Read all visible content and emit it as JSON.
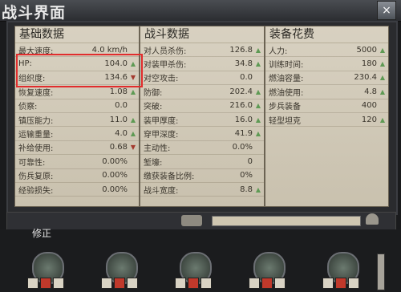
{
  "window": {
    "title": "战斗界面",
    "close_label": "×"
  },
  "panels": {
    "basic": {
      "title": "基础数据",
      "rows": [
        {
          "label": "最大速度:",
          "value": "4.0 km/h",
          "ind": ""
        },
        {
          "label": "HP:",
          "value": "104.0",
          "ind": "up"
        },
        {
          "label": "组织度:",
          "value": "134.6",
          "ind": "down"
        },
        {
          "label": "恢复速度:",
          "value": "1.08",
          "ind": "up"
        },
        {
          "label": "侦察:",
          "value": "0.0",
          "ind": ""
        },
        {
          "label": "镇压能力:",
          "value": "11.0",
          "ind": "up"
        },
        {
          "label": "运输重量:",
          "value": "4.0",
          "ind": "up"
        },
        {
          "label": "补给使用:",
          "value": "0.68",
          "ind": "down"
        },
        {
          "label": "可靠性:",
          "value": "0.00%",
          "ind": ""
        },
        {
          "label": "伤兵复原:",
          "value": "0.00%",
          "ind": ""
        },
        {
          "label": "经验损失:",
          "value": "0.00%",
          "ind": ""
        }
      ]
    },
    "combat": {
      "title": "战斗数据",
      "rows": [
        {
          "label": "对人员杀伤:",
          "value": "126.8",
          "ind": "up"
        },
        {
          "label": "对装甲杀伤:",
          "value": "34.8",
          "ind": "up"
        },
        {
          "label": "对空攻击:",
          "value": "0.0",
          "ind": ""
        },
        {
          "label": "防御:",
          "value": "202.4",
          "ind": "up"
        },
        {
          "label": "突破:",
          "value": "216.0",
          "ind": "up"
        },
        {
          "label": "装甲厚度:",
          "value": "16.0",
          "ind": "up"
        },
        {
          "label": "穿甲深度:",
          "value": "41.9",
          "ind": "up"
        },
        {
          "label": "主动性:",
          "value": "0.0%",
          "ind": ""
        },
        {
          "label": "堑壕:",
          "value": "0",
          "ind": ""
        },
        {
          "label": "缴获装备比例:",
          "value": "0%",
          "ind": ""
        },
        {
          "label": "战斗宽度:",
          "value": "8.8",
          "ind": "up"
        }
      ]
    },
    "cost": {
      "title": "装备花费",
      "rows": [
        {
          "label": "人力:",
          "value": "5000",
          "ind": "up"
        },
        {
          "label": "训练时间:",
          "value": "180",
          "ind": "up"
        },
        {
          "label": "燃油容量:",
          "value": "230.4",
          "ind": "up"
        },
        {
          "label": "燃油使用:",
          "value": "4.8",
          "ind": "up"
        },
        {
          "label": "步兵装备",
          "value": "400",
          "ind": ""
        },
        {
          "label": "轻型坦克",
          "value": "120",
          "ind": "up"
        }
      ]
    }
  },
  "lower": {
    "section_title": "修正"
  }
}
